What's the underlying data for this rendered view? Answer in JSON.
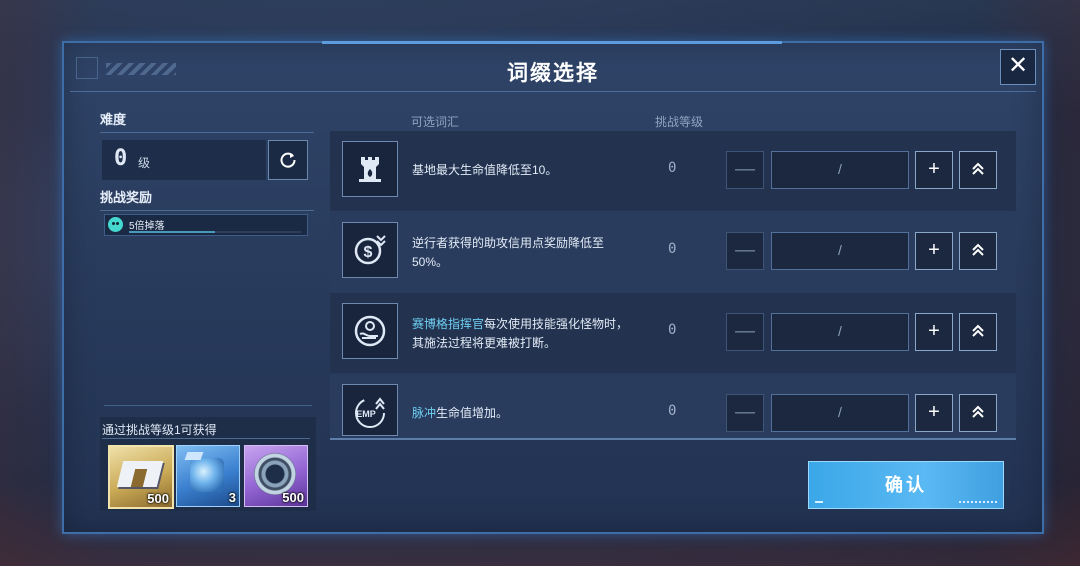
{
  "window": {
    "title": "词缀选择",
    "close_label": "✕"
  },
  "left_panel": {
    "difficulty_label": "难度",
    "difficulty_value": "0",
    "difficulty_unit": "级",
    "reward_label": "挑战奖励",
    "reward_item": {
      "text": "5倍掉落",
      "progress": 0.5
    },
    "obtain_label": "通过挑战等级1可获得",
    "obtain_items": [
      {
        "count": "500"
      },
      {
        "count": "3"
      },
      {
        "count": "500"
      }
    ]
  },
  "table": {
    "col_affix": "可选词汇",
    "col_level": "挑战等级",
    "rows": [
      {
        "desc_parts": [
          "",
          "基地最大生命值降低至10。"
        ],
        "level": "0",
        "field": "/",
        "icon": "tower-icon"
      },
      {
        "desc_parts": [
          "",
          "逆行者获得的助攻信用点奖励降低至50%。"
        ],
        "level": "0",
        "field": "/",
        "icon": "credit-down-icon"
      },
      {
        "desc_parts": [
          "赛博格指挥官",
          "每次使用技能强化怪物时，其施法过程将更难被打断。"
        ],
        "level": "0",
        "field": "/",
        "icon": "hand-orb-icon"
      },
      {
        "desc_parts": [
          "脉冲",
          "生命值增加。"
        ],
        "level": "0",
        "field": "/",
        "icon": "emp-icon"
      }
    ],
    "minus_label": "—",
    "plus_label": "+"
  },
  "confirm_label": "确认",
  "colors": {
    "accent": "#5ab9f3",
    "highlight": "#6fd0f2",
    "panel": "#27395a"
  }
}
